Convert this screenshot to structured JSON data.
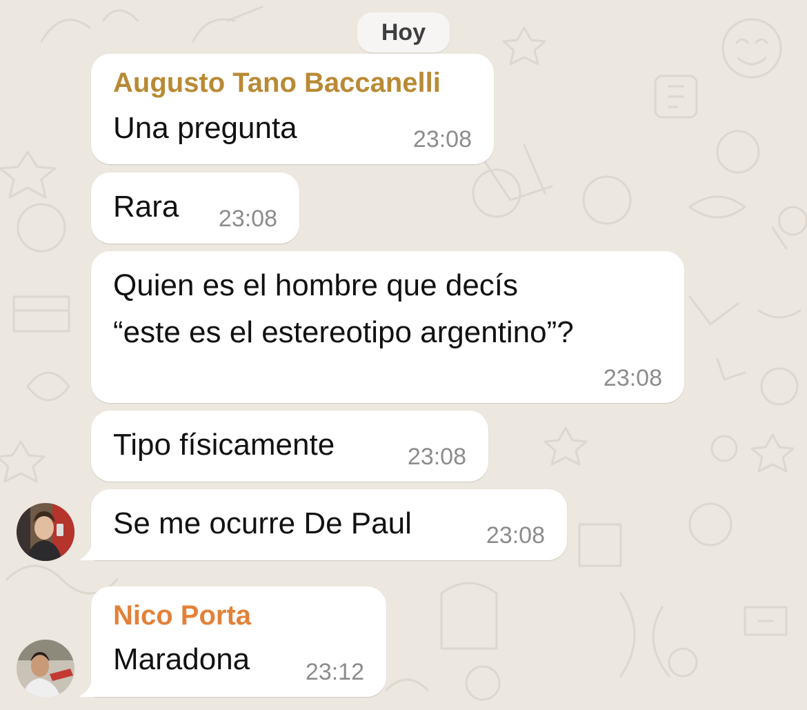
{
  "chat": {
    "date_label": "Hoy",
    "messages": [
      {
        "sender": "Augusto Tano Baccanelli",
        "lines": [
          "Una pregunta"
        ],
        "time": "23:08"
      },
      {
        "lines": [
          "Rara"
        ],
        "time": "23:08"
      },
      {
        "lines": [
          "Quien es el hombre que decís",
          "“este es el estereotipo argentino”?"
        ],
        "time": "23:08"
      },
      {
        "lines": [
          "Tipo físicamente"
        ],
        "time": "23:08"
      },
      {
        "lines": [
          "Se me ocurre De Paul"
        ],
        "time": "23:08"
      },
      {
        "sender": "Nico Porta",
        "lines": [
          "Maradona"
        ],
        "time": "23:12"
      }
    ]
  },
  "colors": {
    "chat_background": "#ece7df",
    "sender_augusto": "#b98a35",
    "sender_nico": "#e3813a",
    "bubble": "#ffffff",
    "time_text": "#8c8c8e"
  }
}
